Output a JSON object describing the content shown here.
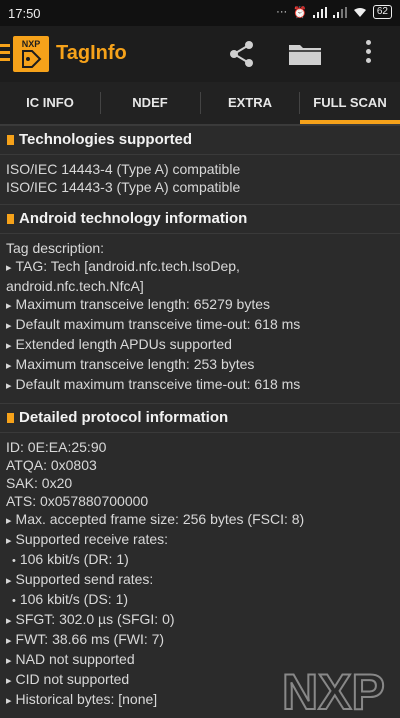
{
  "status_bar": {
    "time": "17:50",
    "battery": "62",
    "icons": [
      "notification-dots-icon",
      "alarm-icon",
      "signal-icon",
      "signal-icon",
      "wifi-icon",
      "battery-icon"
    ]
  },
  "app_bar": {
    "title": "TagInfo",
    "logo_text": "NXP",
    "actions": [
      "share-icon",
      "folder-icon",
      "more-vert-icon"
    ]
  },
  "tabs": [
    {
      "label": "IC INFO",
      "active": false
    },
    {
      "label": "NDEF",
      "active": false
    },
    {
      "label": "EXTRA",
      "active": false
    },
    {
      "label": "FULL SCAN",
      "active": true
    }
  ],
  "sections": {
    "technologies": {
      "title": "Technologies supported",
      "lines": [
        "ISO/IEC 14443-4 (Type A) compatible",
        "ISO/IEC 14443-3 (Type A) compatible"
      ]
    },
    "android": {
      "title": "Android technology information",
      "intro": "Tag description:",
      "tag_line1": "TAG: Tech [android.nfc.tech.IsoDep,",
      "tag_line2": "android.nfc.tech.NfcA]",
      "items": [
        "Maximum transceive length: 65279 bytes",
        "Default maximum transceive time-out: 618 ms",
        "Extended length APDUs supported",
        "Maximum transceive length: 253 bytes",
        "Default maximum transceive time-out: 618 ms"
      ]
    },
    "protocol": {
      "title": "Detailed protocol information",
      "id": "ID: 0E:EA:25:90",
      "atqa": "ATQA: 0x0803",
      "sak": "SAK: 0x20",
      "ats": "ATS: 0x057880700000",
      "max_frame": "Max. accepted frame size: 256 bytes (FSCI: 8)",
      "receive_rates_label": "Supported receive rates:",
      "receive_rate": "106 kbit/s (DR: 1)",
      "send_rates_label": "Supported send rates:",
      "send_rate": "106 kbit/s (DS: 1)",
      "sfgt": "SFGT: 302.0 µs  (SFGI: 0)",
      "fwt": "FWT: 38.66 ms  (FWI: 7)",
      "nad": "NAD not supported",
      "cid": "CID not supported",
      "historical": "Historical bytes: [none]"
    }
  },
  "watermark": "NXP",
  "colors": {
    "accent": "#f6a21a",
    "background": "#2b2b2b",
    "toolbar": "#1d1d1d"
  }
}
